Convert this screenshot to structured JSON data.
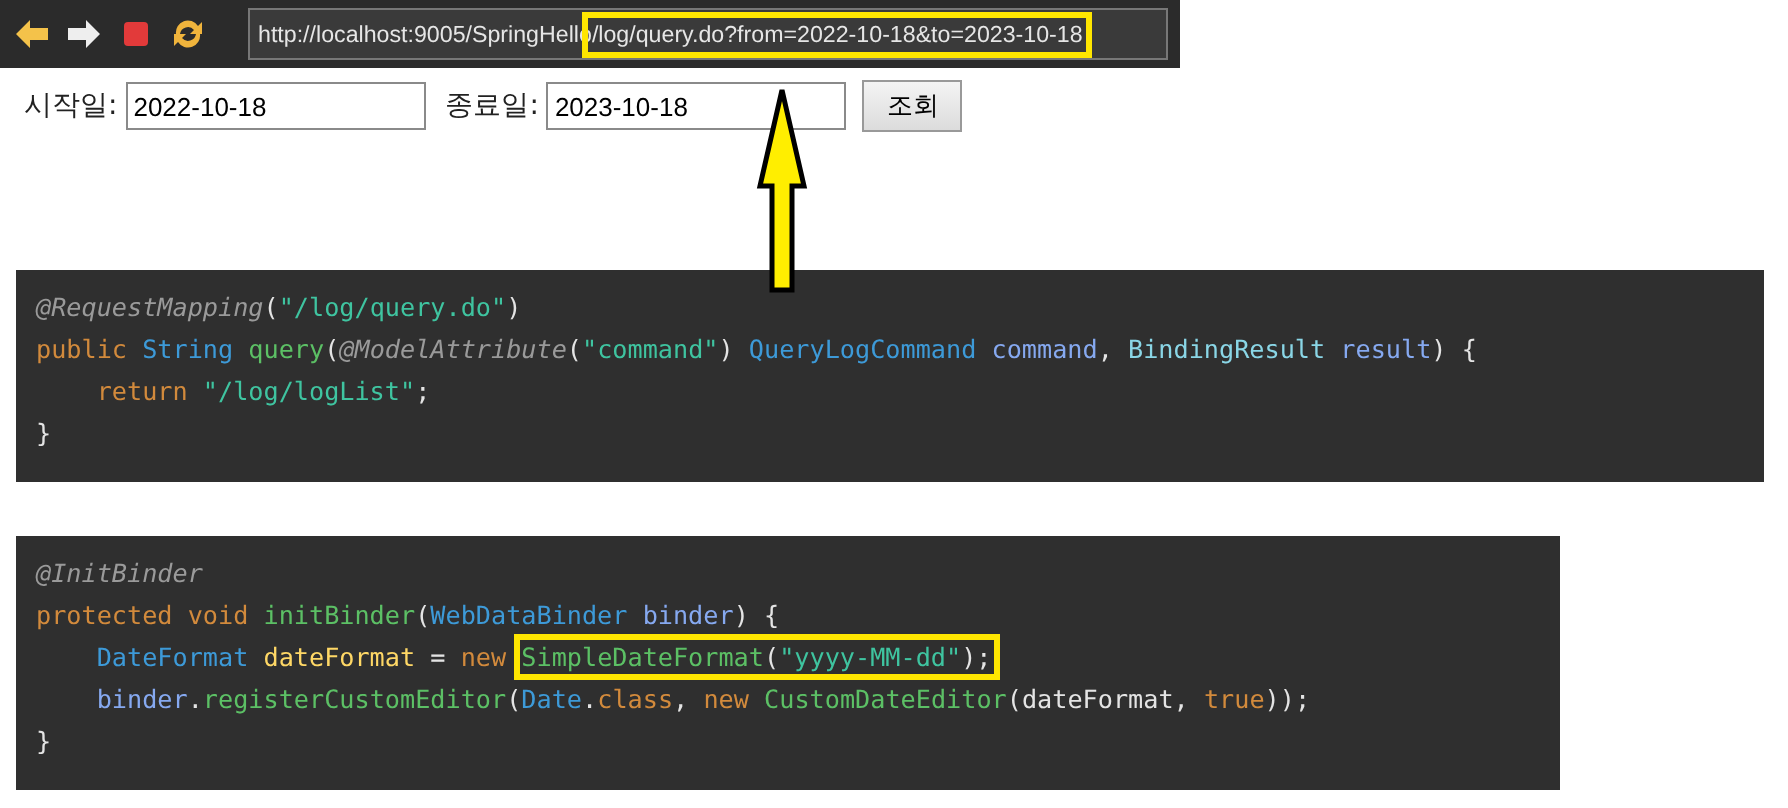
{
  "browser": {
    "buttons": [
      {
        "kind": "back"
      },
      {
        "kind": "forward"
      },
      {
        "kind": "stop"
      },
      {
        "kind": "refresh"
      }
    ],
    "url": [
      {
        "text": "http://localhost:9005/SpringHello",
        "highlighted": false
      },
      {
        "text": "/log/query.do?from=2022-10-18&to=2023-10-18",
        "highlighted": true
      }
    ]
  },
  "form": {
    "fields": [
      {
        "label": "시작일:",
        "value": "2022-10-18"
      },
      {
        "label": "종료일:",
        "value": "2023-10-18"
      }
    ],
    "button": "조회"
  },
  "code_blocks": [
    {
      "lines": [
        [
          {
            "kind": "annotation",
            "text": "@RequestMapping"
          },
          {
            "kind": "plain",
            "text": "("
          },
          {
            "kind": "string",
            "text": "\"/log/query.do\""
          },
          {
            "kind": "plain",
            "text": ")"
          }
        ],
        [
          {
            "kind": "keyword",
            "text": "public "
          },
          {
            "kind": "type",
            "text": "String "
          },
          {
            "kind": "method",
            "text": "query"
          },
          {
            "kind": "plain",
            "text": "("
          },
          {
            "kind": "annotation",
            "text": "@ModelAttribute"
          },
          {
            "kind": "plain",
            "text": "("
          },
          {
            "kind": "string",
            "text": "\"command\""
          },
          {
            "kind": "plain",
            "text": ") "
          },
          {
            "kind": "type",
            "text": "QueryLogCommand "
          },
          {
            "kind": "param",
            "text": "command"
          },
          {
            "kind": "plain",
            "text": ", "
          },
          {
            "kind": "class",
            "text": "BindingResult "
          },
          {
            "kind": "param",
            "text": "result"
          },
          {
            "kind": "plain",
            "text": ") {"
          }
        ],
        [
          {
            "kind": "indent"
          },
          {
            "kind": "keyword",
            "text": "return "
          },
          {
            "kind": "string",
            "text": "\"/log/logList\""
          },
          {
            "kind": "plain",
            "text": ";"
          }
        ],
        [
          {
            "kind": "plain",
            "text": "}"
          }
        ]
      ]
    },
    {
      "lines": [
        [
          {
            "kind": "annotation",
            "text": "@InitBinder"
          }
        ],
        [
          {
            "kind": "keyword",
            "text": "protected void "
          },
          {
            "kind": "method",
            "text": "initBinder"
          },
          {
            "kind": "plain",
            "text": "("
          },
          {
            "kind": "type",
            "text": "WebDataBinder "
          },
          {
            "kind": "param",
            "text": "binder"
          },
          {
            "kind": "plain",
            "text": ") {"
          }
        ],
        [
          {
            "kind": "indent"
          },
          {
            "kind": "type",
            "text": "DateFormat "
          },
          {
            "kind": "var",
            "text": "dateFormat"
          },
          {
            "kind": "plain",
            "text": " = "
          },
          {
            "kind": "keyword",
            "text": "new "
          },
          {
            "kind": "box",
            "tokens": [
              {
                "kind": "method",
                "text": "SimpleDateFormat"
              },
              {
                "kind": "plain",
                "text": "("
              },
              {
                "kind": "string",
                "text": "\"yyyy-MM-dd\""
              },
              {
                "kind": "plain",
                "text": ");"
              }
            ]
          }
        ],
        [
          {
            "kind": "indent"
          },
          {
            "kind": "param",
            "text": "binder"
          },
          {
            "kind": "plain",
            "text": "."
          },
          {
            "kind": "method",
            "text": "registerCustomEditor"
          },
          {
            "kind": "plain",
            "text": "("
          },
          {
            "kind": "type",
            "text": "Date"
          },
          {
            "kind": "plain",
            "text": "."
          },
          {
            "kind": "keyword",
            "text": "class"
          },
          {
            "kind": "plain",
            "text": ", "
          },
          {
            "kind": "keyword",
            "text": "new "
          },
          {
            "kind": "method",
            "text": "CustomDateEditor"
          },
          {
            "kind": "plain",
            "text": "(dateFormat, "
          },
          {
            "kind": "keyword",
            "text": "true"
          },
          {
            "kind": "plain",
            "text": "));"
          }
        ],
        [
          {
            "kind": "plain",
            "text": "}"
          }
        ]
      ]
    }
  ]
}
